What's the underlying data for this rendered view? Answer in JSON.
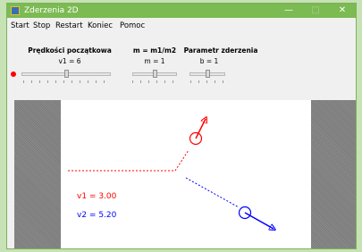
{
  "window": {
    "title": "Zderzenia 2D",
    "controls": {
      "minimize": "—",
      "maximize": "□",
      "close": "✕"
    }
  },
  "menu": [
    "Start",
    "Stop",
    "Restart",
    "Koniec",
    "Pomoc"
  ],
  "controls": {
    "velocity": {
      "title": "Prędkości początkowa",
      "value_label": "v1 = 6",
      "level": 0.5
    },
    "mass": {
      "title": "m = m1/m2",
      "value_label": "m = 1",
      "level": 0.5
    },
    "param": {
      "title": "Parametr zderzenia",
      "value_label": "b = 1",
      "level": 0.5
    }
  },
  "readouts": {
    "v1": "v1 = 3.00",
    "v2": "v2 = 5.20"
  },
  "colors": {
    "ball1": "#ff0000",
    "ball2": "#0000ff",
    "titlebar": "#7cba52",
    "indicator": "#ff0000"
  },
  "icons": {
    "app": "app-icon",
    "indicator": "status-dot"
  }
}
